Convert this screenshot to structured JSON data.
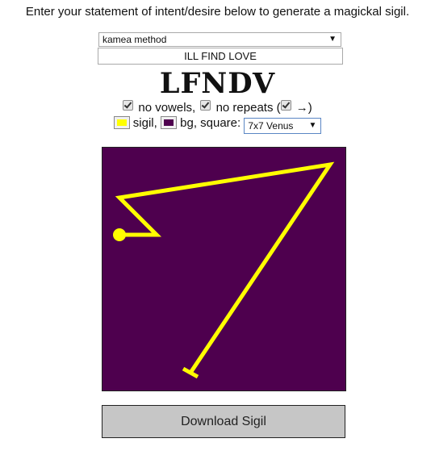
{
  "instructions": "Enter your statement of intent/desire below to generate a magickal sigil.",
  "method_select": {
    "selected": "kamea method"
  },
  "intent_input": {
    "value": "ILL FIND LOVE"
  },
  "sigil_word": "LFNDV",
  "options": {
    "no_vowels_label": "no vowels,",
    "no_repeats_label": "no repeats (",
    "arrow_label": "→)",
    "no_vowels_checked": true,
    "no_repeats_checked": true,
    "arrow_checked": true
  },
  "colors": {
    "sigil_label": "sigil,",
    "bg_label": "bg, square:",
    "sigil_color": "#ffff00",
    "bg_color": "#4e004e"
  },
  "square_select": {
    "selected": "7x7 Venus"
  },
  "download_button": {
    "label": "Download Sigil"
  }
}
